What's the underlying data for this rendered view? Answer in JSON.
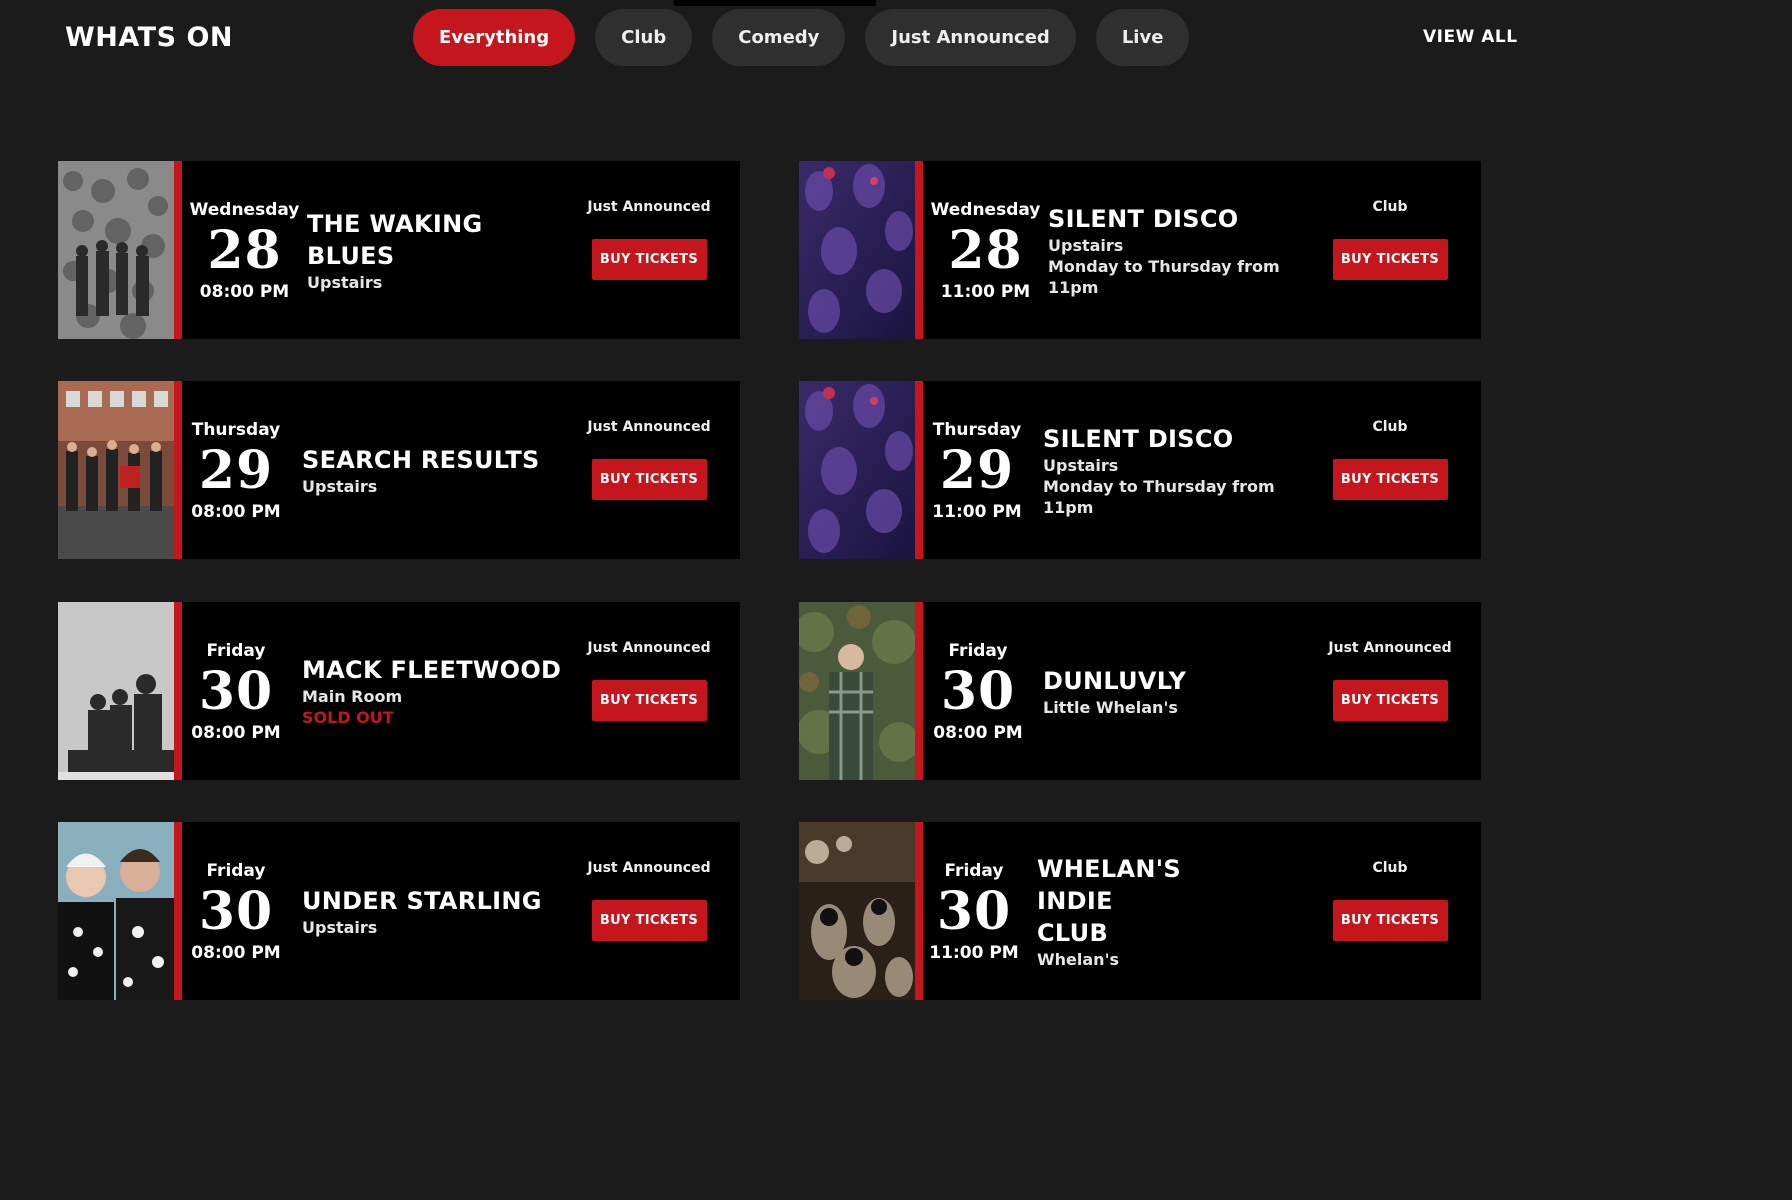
{
  "header": {
    "title": "WHATS ON",
    "view_all": "VIEW ALL",
    "filters": [
      {
        "label": "Everything",
        "active": true
      },
      {
        "label": "Club",
        "active": false
      },
      {
        "label": "Comedy",
        "active": false
      },
      {
        "label": "Just Announced",
        "active": false
      },
      {
        "label": "Live",
        "active": false
      }
    ]
  },
  "colors": {
    "accent": "#c4161c",
    "background": "#1b1b1b",
    "card": "#000000"
  },
  "events": [
    {
      "weekday": "Wednesday",
      "day": "28",
      "time": "08:00 PM",
      "title": "THE WAKING BLUES",
      "venue": "Upstairs",
      "note": "",
      "status": "",
      "tag": "Just Announced",
      "button": "BUY TICKETS"
    },
    {
      "weekday": "Wednesday",
      "day": "28",
      "time": "11:00 PM",
      "title": "SILENT DISCO",
      "venue": "Upstairs",
      "note": "Monday to Thursday from 11pm",
      "status": "",
      "tag": "Club",
      "button": "BUY TICKETS"
    },
    {
      "weekday": "Thursday",
      "day": "29",
      "time": "08:00 PM",
      "title": "SEARCH RESULTS",
      "venue": "Upstairs",
      "note": "",
      "status": "",
      "tag": "Just Announced",
      "button": "BUY TICKETS"
    },
    {
      "weekday": "Thursday",
      "day": "29",
      "time": "11:00 PM",
      "title": "SILENT DISCO",
      "venue": "Upstairs",
      "note": "Monday to Thursday from 11pm",
      "status": "",
      "tag": "Club",
      "button": "BUY TICKETS"
    },
    {
      "weekday": "Friday",
      "day": "30",
      "time": "08:00 PM",
      "title": "MACK FLEETWOOD",
      "venue": "Main Room",
      "note": "",
      "status": "SOLD OUT",
      "tag": "Just Announced",
      "button": "BUY TICKETS"
    },
    {
      "weekday": "Friday",
      "day": "30",
      "time": "08:00 PM",
      "title": "DUNLUVLY",
      "venue": "Little Whelan's",
      "note": "",
      "status": "",
      "tag": "Just Announced",
      "button": "BUY TICKETS"
    },
    {
      "weekday": "Friday",
      "day": "30",
      "time": "08:00 PM",
      "title": "UNDER STARLING",
      "venue": "Upstairs",
      "note": "",
      "status": "",
      "tag": "Just Announced",
      "button": "BUY TICKETS"
    },
    {
      "weekday": "Friday",
      "day": "30",
      "time": "11:00 PM",
      "title": "WHELAN'S INDIE CLUB",
      "venue": "Whelan's",
      "note": "",
      "status": "",
      "tag": "Club",
      "button": "BUY TICKETS"
    }
  ]
}
